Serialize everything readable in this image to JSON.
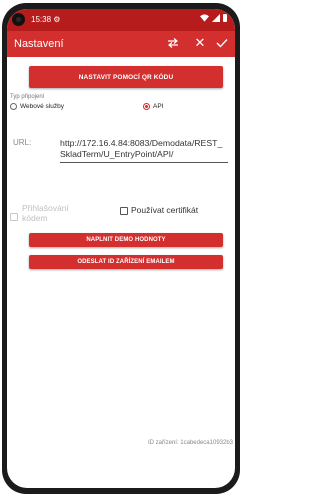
{
  "status_bar": {
    "time": "15:38",
    "sync_icon": "sync-icon"
  },
  "app_bar": {
    "title": "Nastavení",
    "icons": [
      "swap-icon",
      "close-icon",
      "check-icon"
    ]
  },
  "buttons": {
    "qr": "NASTAVIT POMOCÍ QR KÓDU",
    "demo": "NAPLNIT DEMO HODNOTY",
    "email": "ODESLAT ID ZAŘÍZENÍ EMAILEM"
  },
  "connection": {
    "label": "Typ připojení",
    "options": [
      "Webové služby",
      "API"
    ],
    "selected": "API"
  },
  "url": {
    "label": "URL:",
    "value": "http://172.16.4.84:8083/Demodata/REST_SkladTerm/U_EntryPoint/API/"
  },
  "checkboxes": {
    "login": {
      "label": "Přihlašování kódem",
      "checked": false,
      "enabled": false
    },
    "certificate": {
      "label": "Používat certifikát",
      "checked": false,
      "enabled": true
    }
  },
  "device_id": "ID zařízení: 1cabedeca10932b3",
  "colors": {
    "status_bar": "#b71c1c",
    "app_bar": "#d32f2f",
    "accent": "#d32f2f"
  }
}
